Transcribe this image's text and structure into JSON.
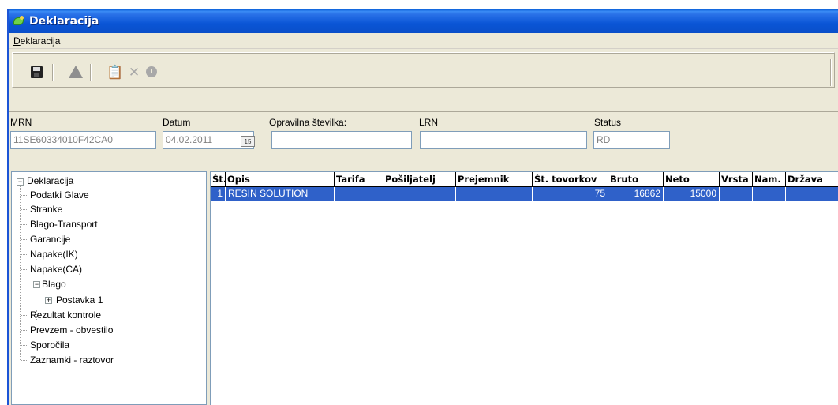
{
  "window": {
    "title": "Deklaracija"
  },
  "menu": {
    "items": [
      {
        "label_u": "D",
        "label_rest": "eklaracija"
      }
    ]
  },
  "toolbar": {
    "buttons": [
      "save-icon",
      "triangle-icon",
      "paste-icon",
      "delete-icon",
      "stop-icon"
    ]
  },
  "fields": {
    "mrn_label": "MRN",
    "mrn_value": "11SE60334010F42CA0",
    "datum_label": "Datum",
    "datum_value": "04.02.2011",
    "calendar_btn": "15",
    "opravilna_label": "Opravilna številka:",
    "opravilna_value": "",
    "lrn_label": "LRN",
    "lrn_value": "",
    "status_label": "Status",
    "status_value": "RD"
  },
  "tree": {
    "root": "Deklaracija",
    "items": [
      "Podatki Glave",
      "Stranke",
      "Blago-Transport",
      "Garancije",
      "Napake(IK)",
      "Napake(CA)"
    ],
    "blago": "Blago",
    "postavka": "Postavka 1",
    "after": [
      "Rezultat kontrole",
      "Prevzem - obvestilo",
      "Sporočila",
      "Zaznamki - raztovor"
    ]
  },
  "grid": {
    "columns": [
      "Št.",
      "Opis",
      "Tarifa",
      "Pošiljatelj",
      "Prejemnik",
      "Št. tovorkov",
      "Bruto",
      "Neto",
      "Vrsta",
      "Nam.",
      "Država"
    ],
    "rows": [
      [
        "1",
        "RESIN SOLUTION",
        "",
        "",
        "",
        "75",
        "16862",
        "15000",
        "",
        "",
        ""
      ]
    ]
  },
  "colors": {
    "titlebar": "#0a55d6",
    "selection": "#2f61c9",
    "face": "#ece9d8"
  }
}
